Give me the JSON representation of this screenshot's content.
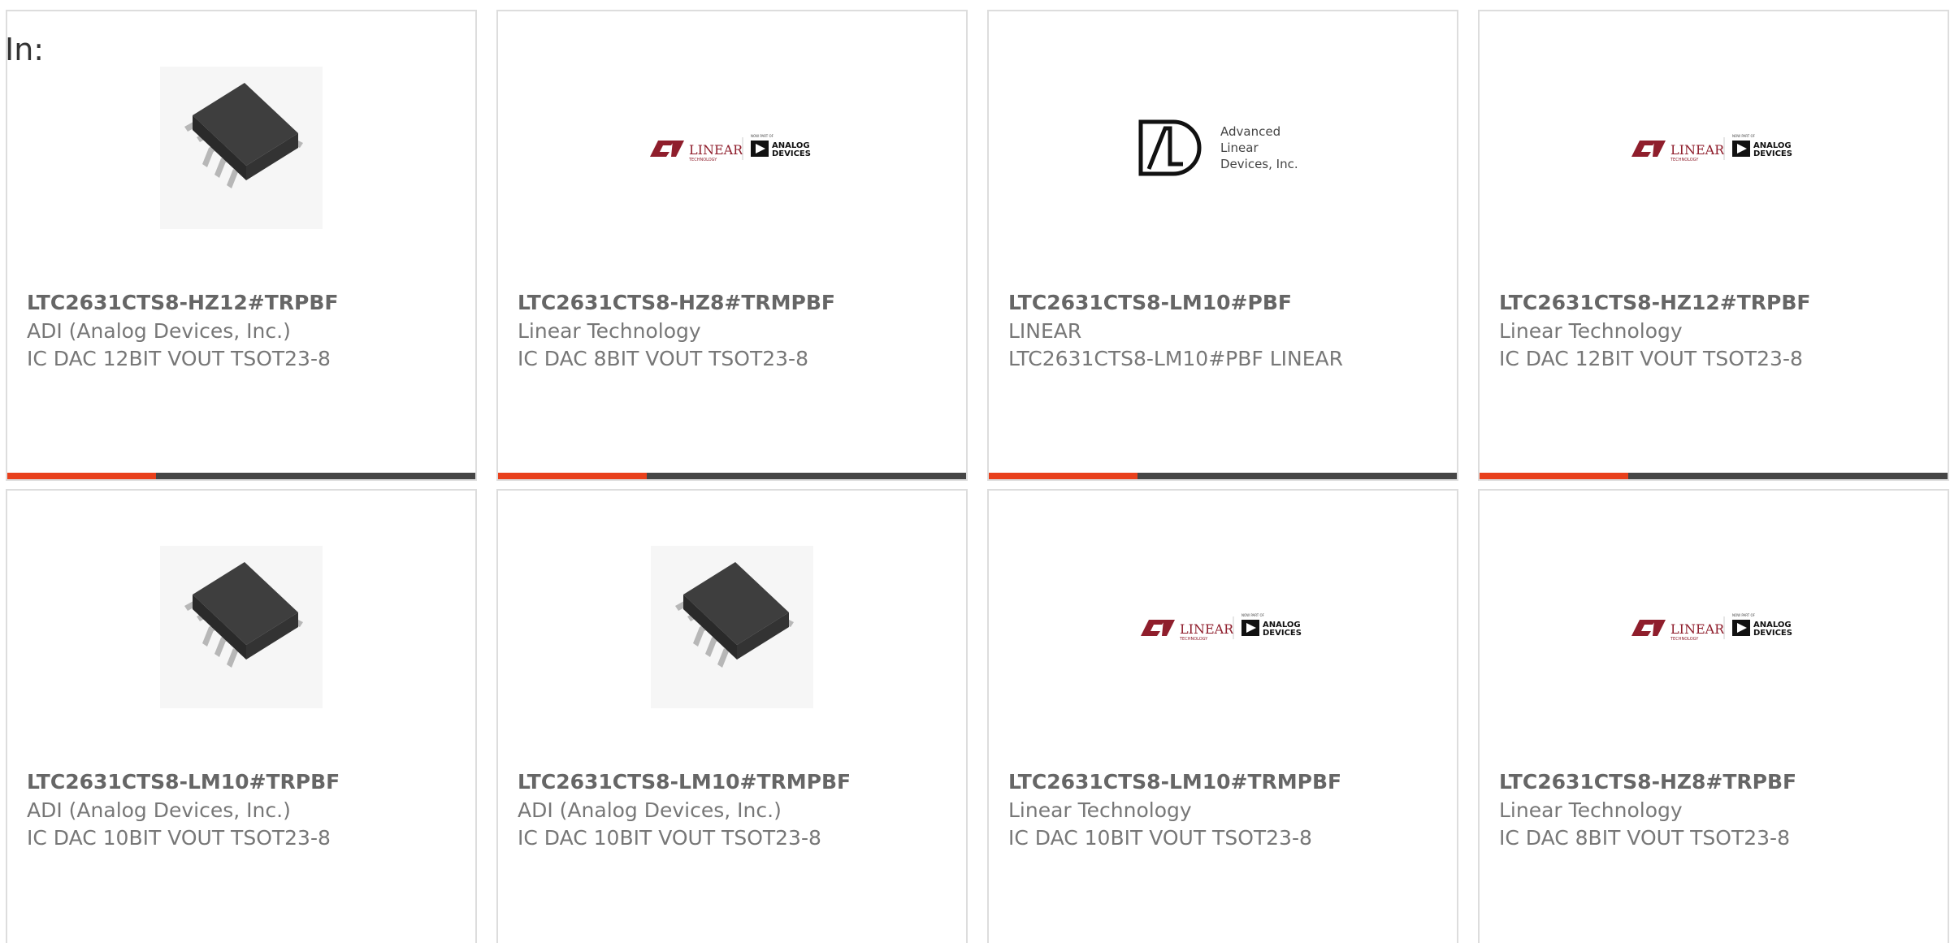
{
  "filter": {
    "label": "In:"
  },
  "colors": {
    "accent": "#e8401c",
    "track": "#454545",
    "card_border": "#dddddd"
  },
  "products": [
    {
      "part": "LTC2631CTS8-HZ12#TRPBF",
      "maker": "ADI (Analog Devices, Inc.)",
      "description": "IC DAC 12BIT VOUT TSOT23-8",
      "image": "ic-chip-image"
    },
    {
      "part": "LTC2631CTS8-HZ8#TRMPBF",
      "maker": "Linear Technology",
      "description": "IC DAC 8BIT VOUT TSOT23-8",
      "image": "linear-analog-logo"
    },
    {
      "part": "LTC2631CTS8-LM10#PBF",
      "maker": "LINEAR",
      "description": "LTC2631CTS8-LM10#PBF LINEAR",
      "image": "ald-logo"
    },
    {
      "part": "LTC2631CTS8-HZ12#TRPBF",
      "maker": "Linear Technology",
      "description": "IC DAC 12BIT VOUT TSOT23-8",
      "image": "linear-analog-logo"
    },
    {
      "part": "LTC2631CTS8-LM10#TRPBF",
      "maker": "ADI (Analog Devices, Inc.)",
      "description": "IC DAC 10BIT VOUT TSOT23-8",
      "image": "ic-chip-image"
    },
    {
      "part": "LTC2631CTS8-LM10#TRMPBF",
      "maker": "ADI (Analog Devices, Inc.)",
      "description": "IC DAC 10BIT VOUT TSOT23-8",
      "image": "ic-chip-image"
    },
    {
      "part": "LTC2631CTS8-LM10#TRMPBF",
      "maker": "Linear Technology",
      "description": "IC DAC 10BIT VOUT TSOT23-8",
      "image": "linear-analog-logo"
    },
    {
      "part": "LTC2631CTS8-HZ8#TRPBF",
      "maker": "Linear Technology",
      "description": "IC DAC 8BIT VOUT TSOT23-8",
      "image": "linear-analog-logo"
    }
  ],
  "logos": {
    "linear": {
      "name": "LINEAR",
      "sub": "TECHNOLOGY",
      "tag": "NOW PART OF",
      "analog_line1": "ANALOG",
      "analog_line2": "DEVICES"
    },
    "ald": {
      "line1": "Advanced",
      "line2": "Linear",
      "line3": "Devices, Inc."
    }
  }
}
